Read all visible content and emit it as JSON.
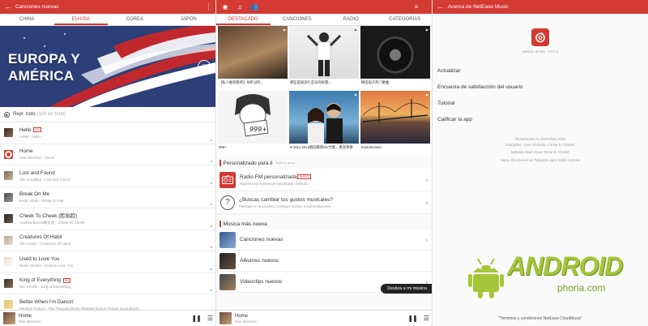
{
  "screen1": {
    "title": "Canciones nuevas",
    "tabs": [
      "CHINA",
      "EU/USA",
      "COREA",
      "JAPÓN"
    ],
    "active_tab": 1,
    "hero_title_line1": "EUROPA Y",
    "hero_title_line2": "AMÉRICA",
    "play_all": "Repr. todo",
    "play_all_count": "(100 en total)",
    "songs": [
      {
        "name": "Hello",
        "artist": "Adele - Hello",
        "badge": "MV"
      },
      {
        "name": "Home",
        "artist": "One Direction - Home",
        "badge": ""
      },
      {
        "name": "Lost and Found",
        "artist": "The Goodbye - Lost and Found",
        "badge": ""
      },
      {
        "name": "Break On Me",
        "artist": "Keith Urban - Break On Me",
        "badge": ""
      },
      {
        "name": "Cheek To Cheek (脸贴脸)",
        "artist": "Andrew Bocelli黄文武 - Cheek To Cheek",
        "badge": ""
      },
      {
        "name": "Creatures Of Habit",
        "artist": "The Kooks - Creatures Of Habit",
        "badge": ""
      },
      {
        "name": "Used to Love You",
        "artist": "Gwen Stefani - Used to Love You",
        "badge": ""
      },
      {
        "name": "King of Everything",
        "artist": "Wiz Khalifa - King of Everything",
        "badge": "MV"
      },
      {
        "name": "Better When I'm Dancin'",
        "artist": "Meghan Trainor - The Peanuts Movie (Original Motion Picture Soundtrack)",
        "badge": ""
      }
    ],
    "player": {
      "name": "Home",
      "artist": "One Direction"
    }
  },
  "screen2": {
    "tabs": [
      "DESTACADO",
      "CANCIONES",
      "RADIO",
      "CATEGORÍAS"
    ],
    "active_tab": 0,
    "grid": [
      {
        "caption": "【私人推荐歌单】你听过的..."
      },
      {
        "caption": "那些美国流行音乐的经典..."
      },
      {
        "caption": "精选电子热门歌曲"
      },
      {
        "caption": "999+"
      },
      {
        "caption": "♥ 2011-2013韩国最新MV合集，重温青春"
      },
      {
        "caption": "Instrumental..."
      }
    ],
    "personal_header": "Personalizado para ti",
    "personal_sub": "según tu gusto",
    "radio_title": "Radio FM personalizada",
    "radio_badge": "NUEVO",
    "radio_sub": "Experiencia musical personalizada. Disfruta.",
    "change_title": "¿Buscas cambiar tus gustos musicales?",
    "change_sub": "Participa en la prueba y consigue nuevas recomendaciones",
    "new_header": "Música más nueva",
    "rows": [
      "Canciones nuevas",
      "Álbumes nuevos",
      "Videoclips nuevos"
    ],
    "toast": "Desliza a mi música",
    "player": {
      "name": "Home",
      "artist": "One Direction"
    }
  },
  "screen3": {
    "title": "Acerca de NetEase Music",
    "version": "Versión actual - V3.0.1",
    "menu": [
      "Actualizar",
      "Encuesta de satisfacción del usuario",
      "Tutorial",
      "Calificar la app"
    ],
    "credits": [
      "TRADUCIDA AL ESPAÑOL POR",
      "JuanjoDM, Jose Arbuleda y Omar E. Chavez",
      "NetEase Mod V3 por Omar E. Chavez",
      "Sigue @netease3 en Telegram para recibir noticias"
    ],
    "terms": "\"Términos y condiciones NetEase CloudMusic\"",
    "watermark_main": "ANDROID",
    "watermark_sub": "phoria.com"
  }
}
